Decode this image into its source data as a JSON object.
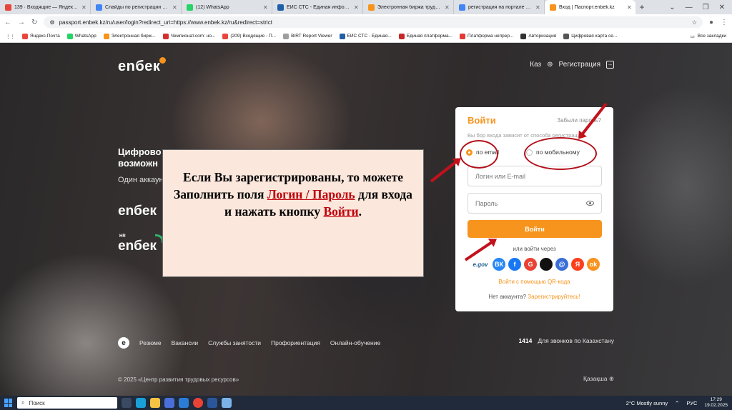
{
  "browser": {
    "tabs": [
      {
        "title": "139 · Входящие — Яндекс По",
        "color": "#e8453c",
        "active": false
      },
      {
        "title": "Слайды по регистрации резю",
        "color": "#4285f4",
        "active": false
      },
      {
        "title": "(12) WhatsApp",
        "color": "#25d366",
        "active": false
      },
      {
        "title": "ЕИС СТС - Единая информаци",
        "color": "#1f5fa8",
        "active": false
      },
      {
        "title": "Электронная биржа труда | Ре",
        "color": "#f7941d",
        "active": false
      },
      {
        "title": "регистрация на портале элек",
        "color": "#4285f4",
        "active": false
      },
      {
        "title": "Вход | Паспорт.enbek.kz",
        "color": "#f7941d",
        "active": true
      }
    ],
    "new_tab": "+",
    "window_controls": [
      "⌄",
      "—",
      "❐",
      "✕"
    ],
    "nav": {
      "back": "←",
      "forward": "→",
      "reload": "↻",
      "menu": "⋮"
    },
    "url": "passport.enbek.kz/ru/user/login?redirect_uri=https://www.enbek.kz/ru&redirect=strict",
    "star": "☆",
    "bookmarks": [
      {
        "label": "Яндекс.Почта",
        "color": "#e8453c"
      },
      {
        "label": "WhatsApp",
        "color": "#25d366"
      },
      {
        "label": "Электронная бирж...",
        "color": "#f7941d"
      },
      {
        "label": "Чемпионат.com: но...",
        "color": "#d32f2f"
      },
      {
        "label": "(209) Входящие - П...",
        "color": "#e8453c"
      },
      {
        "label": "BIRT Report Viewer",
        "color": "#9e9e9e"
      },
      {
        "label": "ЕИС СТС - Единая...",
        "color": "#1f5fa8"
      },
      {
        "label": "Единая платформа...",
        "color": "#c62828"
      },
      {
        "label": "Платформа непрер...",
        "color": "#e53935"
      },
      {
        "label": "Авторизация",
        "color": "#333333"
      },
      {
        "label": "Цифровая карта се...",
        "color": "#555555"
      }
    ],
    "all_bookmarks": "Все закладки"
  },
  "site": {
    "logo": "enбек",
    "lang": "Каз",
    "register_link": "Регистрация",
    "hero_title_1": "Цифрово",
    "hero_title_2": "возможн",
    "hero_sub": "Один аккаун",
    "brand2": "enбек",
    "brand3_tag": "HR",
    "brand3": "enбек"
  },
  "login": {
    "title": "Войти",
    "forgot": "Забыли пароль?",
    "hint": "Вы бор входа зависит от способа регистрации",
    "radio_email": "по email",
    "radio_phone": "по мобильному",
    "login_placeholder": "Логин или E-mail",
    "password_placeholder": "Пароль",
    "submit": "Войти",
    "or": "или войти через",
    "socials": [
      {
        "label": "e.gov",
        "color": "#1a5b8f"
      },
      {
        "label": "ВК",
        "color": "#2787f5"
      },
      {
        "label": "f",
        "color": "#1877f2"
      },
      {
        "label": "G",
        "color": "#ea4335"
      },
      {
        "label": "",
        "color": "#111111"
      },
      {
        "label": "@",
        "color": "#3a6fd8"
      },
      {
        "label": "Я",
        "color": "#fc3f1d"
      },
      {
        "label": "ok",
        "color": "#f7931e"
      }
    ],
    "qr": "Войти с помощью QR-кода",
    "no_account": "Нет аккаунта?",
    "register": "Зарегистрируйтесь!"
  },
  "note": {
    "line1": "Если Вы зарегистрированы, то можете Заполнить поля",
    "link1": "Логин / Пароль",
    "line2": "для входа и нажать кнопку",
    "link2": "Войти",
    "end": "."
  },
  "footer": {
    "logo_letter": "e",
    "nav": [
      "Резюме",
      "Вакансии",
      "Службы занятости",
      "Профориентация",
      "Онлайн-обучение"
    ],
    "hotline_number": "1414",
    "hotline_text": "Для звонков по Казахстану",
    "copyright": "© 2025 «Центр развития трудовых ресурсов»",
    "lang": "Қазақша"
  },
  "taskbar": {
    "search": "Поиск",
    "weather": "2°C  Mostly sunny",
    "lang": "РУС",
    "time": "17:29",
    "date": "19.02.2025"
  }
}
